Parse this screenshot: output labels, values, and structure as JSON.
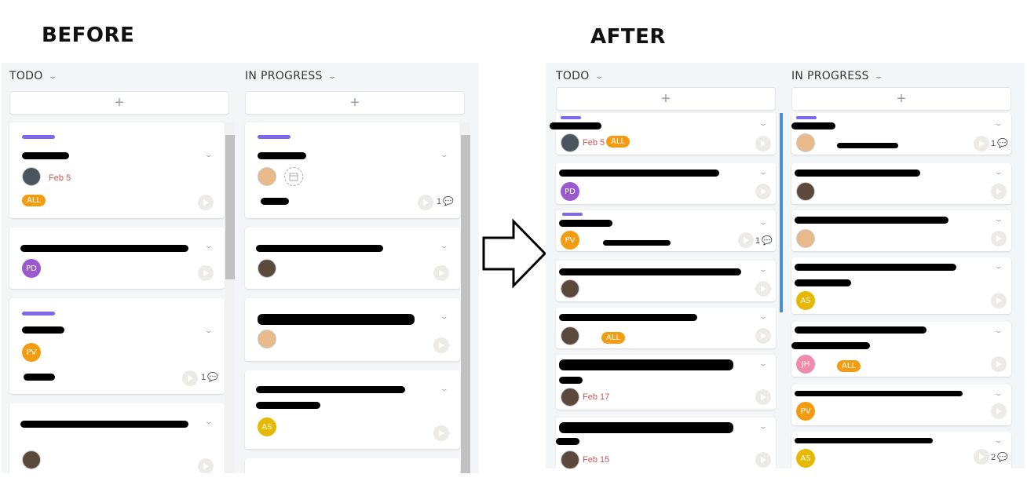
{
  "labels": {
    "before": "BEFORE",
    "after": "AFTER"
  },
  "columns": {
    "todo": "TODO",
    "in_progress": "IN PROGRESS"
  },
  "add_symbol": "+",
  "chevron": "⌄",
  "tag_all": "ALL",
  "dates": {
    "feb5": "Feb 5",
    "feb17": "Feb 17",
    "feb15": "Feb 15"
  },
  "avatars": {
    "pd": "PD",
    "pv": "PV",
    "as": "AS",
    "jh": "JH"
  },
  "comments": {
    "one": "1",
    "two": "2"
  },
  "colors": {
    "accent_purple": "#7b68ee",
    "tag_orange": "#f39c12",
    "date_red": "#d9534f",
    "pd": "#9b59d0",
    "pv": "#f39c12",
    "as": "#e6b800",
    "jh": "#f08caa"
  }
}
